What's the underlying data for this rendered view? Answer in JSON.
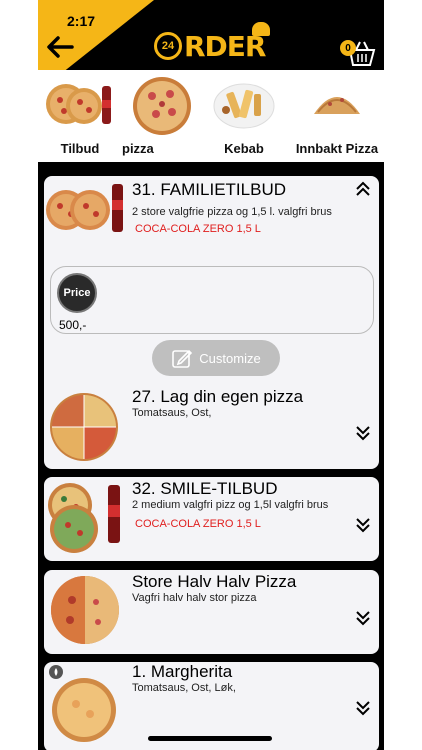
{
  "status": {
    "time": "2:17"
  },
  "header": {
    "logo_badge": "24",
    "logo_text": "RDER",
    "cart_count": "0"
  },
  "categories": [
    {
      "label": "Tilbud",
      "image": "pizza-and-cola"
    },
    {
      "label": "pizza",
      "image": "pizza",
      "active": true
    },
    {
      "label": "Kebab",
      "image": "kebab-plate"
    },
    {
      "label": "Innbakt Pizza",
      "image": "calzone"
    }
  ],
  "items": [
    {
      "title": "31. FAMILIETILBUD",
      "desc": "2 store valgfrie pizza og 1,5 l. valgfri brus",
      "option": "COCA-COLA ZERO 1,5 L",
      "expanded": true,
      "price_label": "Price",
      "price": "500,-",
      "customize_label": "Customize"
    },
    {
      "title": "27. Lag din egen pizza",
      "desc": "Tomatsaus, Ost,"
    },
    {
      "title": "32. SMILE-TILBUD",
      "desc": "2 medium valgfri pizz og 1,5l valgfri brus",
      "option": "COCA-COLA ZERO 1,5 L"
    },
    {
      "title": "Store Halv Halv Pizza",
      "desc": "Vagfri halv halv stor pizza"
    },
    {
      "title": "1. Margherita",
      "desc": "Tomatsaus, Ost, Løk,"
    }
  ],
  "colors": {
    "accent": "#f5b617",
    "option_red": "#e01e1e",
    "card_bg": "#f4f4f7"
  }
}
